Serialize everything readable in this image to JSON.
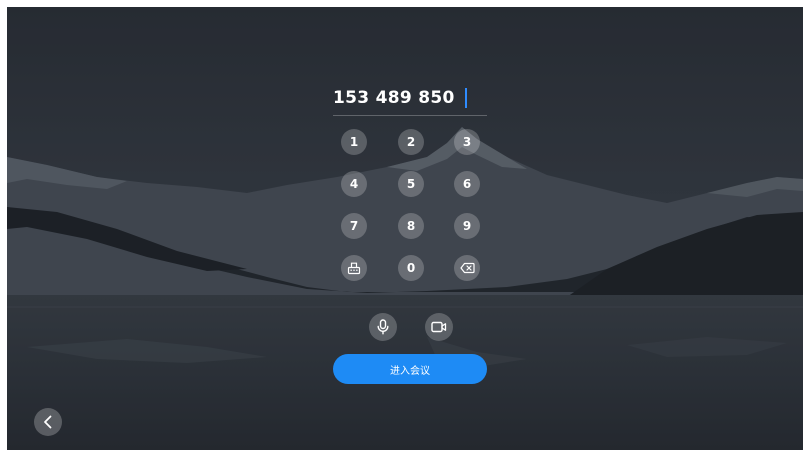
{
  "input": {
    "meeting_number": "153 489 850"
  },
  "keypad": {
    "keys": [
      "1",
      "2",
      "3",
      "4",
      "5",
      "6",
      "7",
      "8",
      "9",
      "0"
    ],
    "left_action_icon": "keyboard-icon",
    "right_action_icon": "backspace-icon"
  },
  "media": {
    "mic_icon": "microphone-icon",
    "camera_icon": "video-camera-icon"
  },
  "actions": {
    "join_label": "进入会议",
    "back_icon": "chevron-left-icon"
  },
  "colors": {
    "accent": "#1e8bf5",
    "caret": "#2f8cff"
  }
}
